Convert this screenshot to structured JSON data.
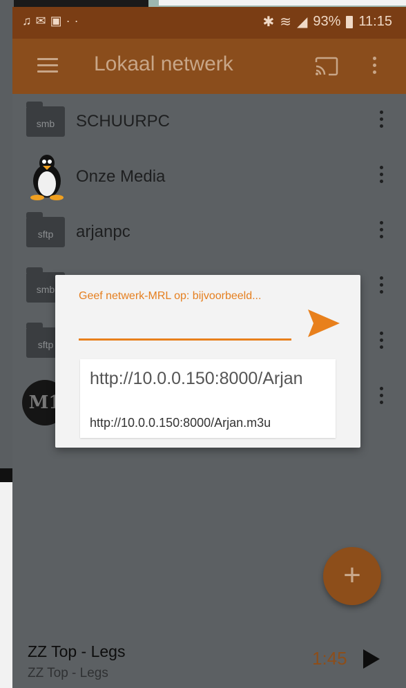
{
  "status_bar": {
    "left_icons": [
      "notification-icon",
      "mail-icon",
      "image-icon",
      "more-dots-icon"
    ],
    "right_icons": [
      "bluetooth-icon",
      "wifi-icon",
      "signal-icon",
      "battery-icon"
    ],
    "battery_percent": "93%",
    "time": "11:15"
  },
  "app_bar": {
    "title": "Lokaal netwerk"
  },
  "list": {
    "items": [
      {
        "label": "SCHUURPC",
        "type_badge": "smb"
      },
      {
        "label": "Onze Media",
        "type_badge": ""
      },
      {
        "label": "arjanpc",
        "type_badge": "sftp"
      },
      {
        "label": "",
        "type_badge": "smb"
      },
      {
        "label": "",
        "type_badge": "sftp"
      },
      {
        "label": "",
        "type_badge": "M1"
      }
    ]
  },
  "dialog": {
    "label": "Geef netwerk-MRL op: bijvoorbeeld...",
    "input_value": "",
    "suggestion": {
      "title": "http://10.0.0.150:8000/Arjan",
      "subtitle": "http://10.0.0.150:8000/Arjan.m3u"
    }
  },
  "fab": {
    "label": "+"
  },
  "player": {
    "title": "ZZ Top - Legs",
    "artist": "ZZ Top - Legs",
    "time": "1:45"
  },
  "colors": {
    "accent": "#e8801c",
    "appbar": "#8a4d1c",
    "statusbar": "#7a3d14"
  }
}
